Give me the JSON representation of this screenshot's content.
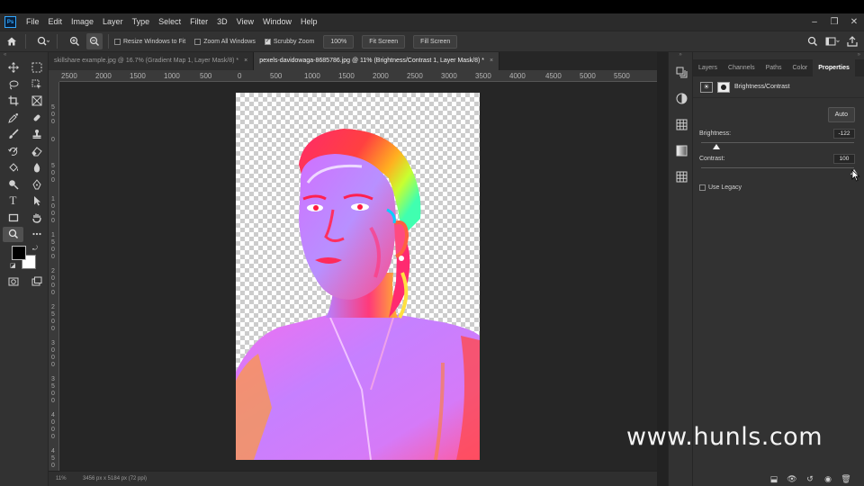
{
  "menubar": {
    "logo": "Ps",
    "items": [
      "File",
      "Edit",
      "Image",
      "Layer",
      "Type",
      "Select",
      "Filter",
      "3D",
      "View",
      "Window",
      "Help"
    ],
    "window_controls": [
      "–",
      "❐",
      "✕"
    ]
  },
  "options": {
    "resize_windows": "Resize Windows to Fit",
    "zoom_all": "Zoom All Windows",
    "scrubby_zoom": "Scrubby Zoom",
    "scrubby_checked": true,
    "zoom_value": "100%",
    "fit_screen": "Fit Screen",
    "fill_screen": "Fill Screen"
  },
  "tabs": [
    {
      "label": "skillshare example.jpg @ 16.7% (Gradient Map 1, Layer Mask/8) *",
      "close": "×",
      "active": false
    },
    {
      "label": "pexels-davidowaga-8685786.jpg @ 11% (Brightness/Contrast 1, Layer Mask/8) *",
      "close": "×",
      "active": true
    }
  ],
  "ruler_h": [
    "2500",
    "2000",
    "1500",
    "1000",
    "500",
    "0",
    "500",
    "1000",
    "1500",
    "2000",
    "2500",
    "3000",
    "3500",
    "4000",
    "4500",
    "5000",
    "5500"
  ],
  "status": {
    "zoom": "11%",
    "info": "3456 px x 5184 px (72 ppi)"
  },
  "panel": {
    "tabs": [
      "Layers",
      "Channels",
      "Paths",
      "Color",
      "Properties"
    ],
    "active_tab": "Properties",
    "adjustment_title": "Brightness/Contrast",
    "auto_label": "Auto",
    "brightness_label": "Brightness:",
    "brightness_value": "-122",
    "brightness_fraction": 0.098,
    "contrast_label": "Contrast:",
    "contrast_value": "100",
    "contrast_fraction": 1.0,
    "use_legacy_label": "Use Legacy"
  },
  "watermark": "www.hunls.com",
  "colors": {
    "accent": "#31a8ff",
    "foreground_swatch": "#000000",
    "background_swatch": "#ffffff"
  }
}
